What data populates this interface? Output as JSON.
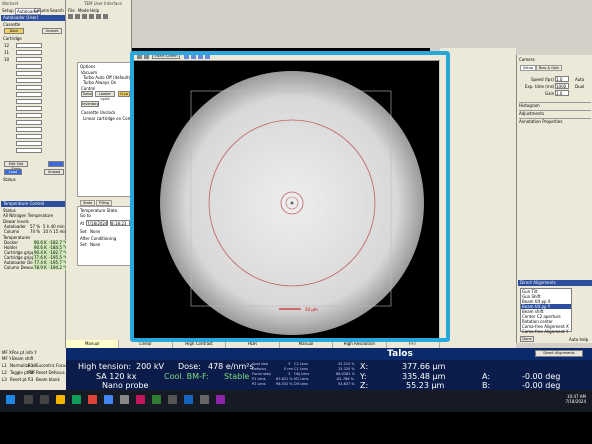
{
  "window": {
    "title_left": "Workset",
    "title_main": "TEM User Interface",
    "menu": [
      "File",
      "Mode",
      "Help"
    ],
    "left_tabs": [
      "Setup",
      "Autoloader",
      "Column",
      "Search"
    ]
  },
  "autoloader": {
    "title": "Autoloader (User)",
    "cassette_label": "Cassette",
    "dock_button": "Dock",
    "undock_button": "Undock",
    "cartridge_label": "Cartridge",
    "slots": [
      "12",
      "11",
      "10"
    ],
    "edit_slot_state": "Edit Slot State",
    "load_button": "Load",
    "unload_button": "Unload",
    "status_label": "Status"
  },
  "temperature": {
    "title": "Temperature Control",
    "status_label": "Status",
    "status_value": "All Nitrogen Temperature",
    "dewar_label": "Dewar levels",
    "autoloader_label": "Autoloader",
    "autoloader_pct": "57 %",
    "autoloader_time": "5 h 40 min",
    "column_label": "Column",
    "column_pct": "74 %",
    "column_time": "10 h 15 min",
    "temps_label": "Temperatures",
    "rows": [
      {
        "name": "Docker",
        "a": "90.6 K",
        "b": "-182.7 °C"
      },
      {
        "name": "Holder",
        "a": "90.6 K",
        "b": "-184.5 °C"
      },
      {
        "name": "Cartridge gripper",
        "a": "90.4 K",
        "b": "-182.7 °C"
      },
      {
        "name": "Cartridge gripper",
        "a": "77.6 K",
        "b": "-195.5 °C"
      },
      {
        "name": "Autoloader Dewar",
        "a": "77.4 K",
        "b": "-195.7 °C"
      },
      {
        "name": "Column Dewar",
        "a": "78.9 K",
        "b": "-194.2 °C"
      }
    ]
  },
  "options": {
    "title": "Options",
    "vacuum_label": "Vacuum",
    "turbo_on_off": "Turbo Auto Off (default)",
    "turbo_always_on": "Turbo Always On",
    "control_label": "Control",
    "turbo_button": "Turbo",
    "loader_cycle": "Loader cycle",
    "cryo_button": "Cryo",
    "inventory": "Inventory",
    "cassette_unclock": "Cassette Unclock",
    "linear_cartridge": "Linear cartridge on CompuStage"
  },
  "state_panel": {
    "tab_state": "State",
    "tab_filling": "Filling",
    "temp_state_label": "Temperature State",
    "go_to": "Go to",
    "at_label": "At",
    "date_value": "7/18/2024",
    "time_value": "8:18:23",
    "set_label": "Set",
    "set_value": "None",
    "after_cond_label": "After Conditioning",
    "set2_value": "None"
  },
  "image_toolbar": {
    "insert_screen": "Insert Screen",
    "scale_bar": "50 µm"
  },
  "mode_tabs": [
    "Manual",
    "Linear",
    "High Contrast",
    "HDR",
    "Manual",
    "High Resolution",
    "FFT"
  ],
  "camera_panel": {
    "title": "Camera",
    "tab_setup": "Setup",
    "tab_bias": "Bias & Gain",
    "speed_label": "Speed (fps)",
    "speed_value": "1.0",
    "auto_label": "Auto",
    "exposure_label": "Exp. time (ms)",
    "exposure_value": "1000",
    "dual_label": "Dual",
    "gain_label": "Gain",
    "gain_value": "1.0",
    "histogram": "Histogram",
    "adjustments": "Adjustments",
    "annotation": "Annotation Properties"
  },
  "direct_alignments": {
    "title": "Direct Alignments",
    "items": [
      "Gun Tilt",
      "Gun Shift",
      "Beam tilt pp X",
      "Beam tilt pp Y",
      "Beam shift",
      "Center C2 aperture",
      "Rotation center",
      "Coma-free Alignment X",
      "Coma-free Alignment Y"
    ],
    "selected_index": 3,
    "done_button": "Done",
    "auto_help": "Auto help"
  },
  "talos": {
    "title": "Talos",
    "dropdown": "Direct Alignments",
    "row_labels": [
      "MF X",
      "Pos pt info Y",
      "MF Y",
      "Beam shift",
      "L1",
      "Normalize all",
      "R1",
      "Eucentric Focus",
      "L2",
      "Toggle pt MF",
      "R2",
      "Reset Defocus",
      "L3",
      "Reset pt",
      "R3",
      "Beam blank"
    ],
    "high_tension_label": "High tension:",
    "high_tension_value": "200 kV",
    "dose_label": "Dose:",
    "dose_value": "478 e/nm²s",
    "mag_value": "SA 120 kx",
    "cool_value": "Cool. BM-F:",
    "stable_value": "Stable",
    "probe_value": "Nano probe",
    "spot_label": "Spot size",
    "spot_value": "3",
    "defocus_label": "Defocus",
    "defocus_value": "0 nm",
    "focus_step_label": "Focus step",
    "focus_step_value": "3",
    "p1_label": "P1 Lens",
    "p1_value": "83.631 %",
    "p2_label": "P2 Lens",
    "p2_value": "98.032 %",
    "c2_label": "C2 Lens",
    "c2_value": "42.210 %",
    "c1_label": "C1 Lens",
    "c1_value": "15.320 %",
    "obj_label": "Obj Lens",
    "obj_value": "88.0382 %",
    "m1_label": "M1 Lens",
    "m1_value": "-81.786 %",
    "diff_label": "Dif Lens",
    "diff_value": "54.837 %",
    "x_label": "X:",
    "x_value": "377.66 µm",
    "y_label": "Y:",
    "y_value": "335.48 µm",
    "z_label": "Z:",
    "z_value": "55.23 µm",
    "a_label": "A:",
    "a_value": "-0.00 deg",
    "b_label": "B:",
    "b_value": "-0.00 deg"
  },
  "taskbar": {
    "time": "10:47 AM",
    "date": "7/18/2024"
  },
  "colors": {
    "highlight": "#27a8dc",
    "talos_bar": "#0a2a6e",
    "status_bg": "#0b1c4a"
  }
}
